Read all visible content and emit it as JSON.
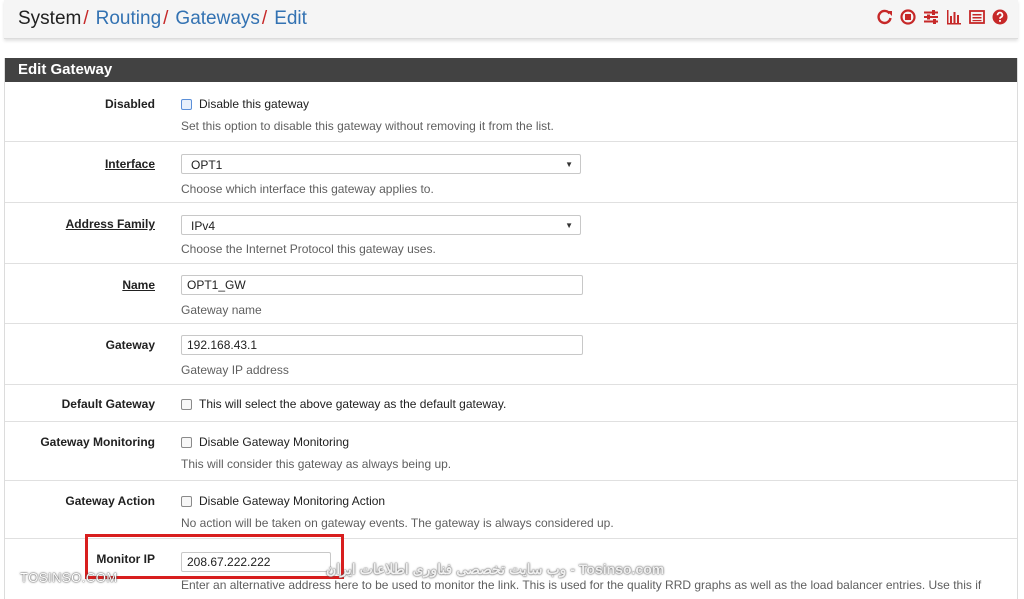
{
  "breadcrumb": {
    "items": [
      "System",
      "Routing",
      "Gateways",
      "Edit"
    ],
    "separator": "/"
  },
  "toolbar_icons": [
    "restart-icon",
    "stop-icon",
    "settings-sliders-icon",
    "bar-chart-icon",
    "log-list-icon",
    "help-icon"
  ],
  "panel": {
    "title": "Edit Gateway"
  },
  "form": {
    "disabled": {
      "label": "Disabled",
      "checkbox_label": "Disable this gateway",
      "help": "Set this option to disable this gateway without removing it from the list."
    },
    "interface": {
      "label": "Interface",
      "value": "OPT1",
      "help": "Choose which interface this gateway applies to."
    },
    "address_family": {
      "label": "Address Family",
      "value": "IPv4",
      "help": "Choose the Internet Protocol this gateway uses."
    },
    "name": {
      "label": "Name",
      "value": "OPT1_GW",
      "help": "Gateway name"
    },
    "gateway": {
      "label": "Gateway",
      "value": "192.168.43.1",
      "help": "Gateway IP address"
    },
    "default_gateway": {
      "label": "Default Gateway",
      "checkbox_label": "This will select the above gateway as the default gateway."
    },
    "gateway_monitoring": {
      "label": "Gateway Monitoring",
      "checkbox_label": "Disable Gateway Monitoring",
      "help": "This will consider this gateway as always being up."
    },
    "gateway_action": {
      "label": "Gateway Action",
      "checkbox_label": "Disable Gateway Monitoring Action",
      "help": "No action will be taken on gateway events. The gateway is always considered up."
    },
    "monitor_ip": {
      "label": "Monitor IP",
      "value": "208.67.222.222",
      "help": "Enter an alternative address here to be used to monitor the link. This is used for the quality RRD graphs as well as the load balancer entries. Use this if"
    }
  },
  "watermark": {
    "left": "TOSINSO.COM",
    "center": "وب سایت تخصصی فناوری اطلاعات ایران - Tosinso.com"
  },
  "colors": {
    "accent_link": "#3372b2",
    "separator": "#c62828",
    "panel_heading": "#424242",
    "highlight_box": "#d81e1e"
  }
}
